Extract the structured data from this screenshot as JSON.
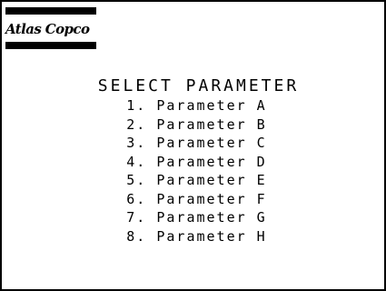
{
  "brand": {
    "logo_text": "Atlas Copco"
  },
  "menu": {
    "title": "SELECT PARAMETER",
    "items": [
      {
        "label": "1. Parameter A"
      },
      {
        "label": "2. Parameter B"
      },
      {
        "label": "3. Parameter C"
      },
      {
        "label": "4. Parameter D"
      },
      {
        "label": "5. Parameter E"
      },
      {
        "label": "6. Parameter F"
      },
      {
        "label": "7. Parameter G"
      },
      {
        "label": "8. Parameter H"
      }
    ]
  },
  "colors": {
    "background": "#ffffff",
    "foreground": "#000000"
  }
}
